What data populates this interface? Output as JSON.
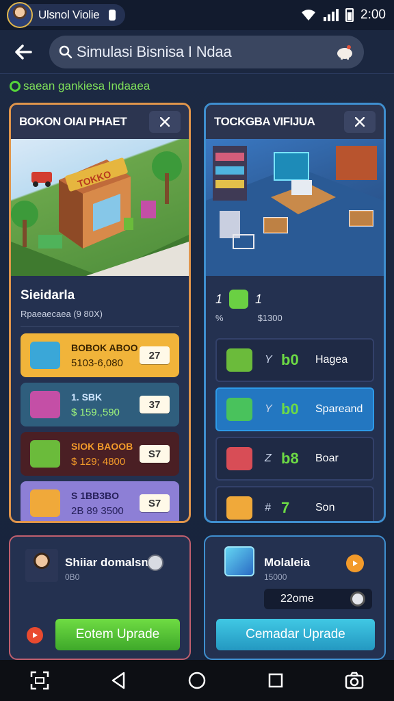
{
  "status_bar": {
    "user_name": "Ulsnol Violie",
    "time": "2:00"
  },
  "header": {
    "search_text": "Simulasi Bisnisa I Ndaa"
  },
  "subtitle": "saean gankiesa Indaaea",
  "left_panel": {
    "title": "BOKON OIAI PHAET",
    "scene_sign": "TOKKO",
    "info_title": "Sieidarla",
    "info_sub": "Rpaeaecaea (9 80X)",
    "items": [
      {
        "line1": "BOBOK ABOO",
        "line2": "5103-6,080",
        "price": "27",
        "bg": "#f1b43a",
        "fg": "#3a2400",
        "icon_color": "#3aa7d8"
      },
      {
        "line1": "1. SBK",
        "line2": "$ 159.,590",
        "price": "37",
        "bg": "#2f5e7d",
        "fg": "#cfe6ff",
        "line2_color": "#9ff57c",
        "icon_color": "#c44fa6"
      },
      {
        "line1": "SIOK BAOOB",
        "line2": "$ 129; 4800",
        "price": "S7",
        "bg": "#4a1f24",
        "fg": "#f29a2a",
        "icon_color": "#6bbb3b"
      },
      {
        "line1": "S 1BB3BO",
        "line2": "2B 89 3500",
        "price": "S7",
        "bg": "#8d7fd6",
        "fg": "#26205a",
        "icon_color": "#f0a93a"
      }
    ]
  },
  "right_panel": {
    "title": "TOCKGBA VIFIJUA",
    "head_left": "1",
    "head_right": "1",
    "sub_left": "%",
    "sub_right": "$1300",
    "items": [
      {
        "mult": "Y",
        "level": "b0",
        "name": "Hagea",
        "icon_color": "#6bbb3b",
        "active": false
      },
      {
        "mult": "Y",
        "level": "b0",
        "name": "Spareand",
        "icon_color": "#49c25c",
        "active": true
      },
      {
        "mult": "Z",
        "level": "b8",
        "name": "Boar",
        "icon_color": "#d84d56",
        "active": false
      },
      {
        "mult": "#",
        "level": "7",
        "name": "Son",
        "icon_color": "#f0a93a",
        "active": false
      }
    ]
  },
  "manager_card": {
    "title": "Shiiar domalsn",
    "sub": "0B0",
    "button": "Eotem Uprade"
  },
  "module_card": {
    "title": "Molaleia",
    "sub": "15000",
    "timer": "22ome",
    "button": "Cemadar Uprade"
  }
}
